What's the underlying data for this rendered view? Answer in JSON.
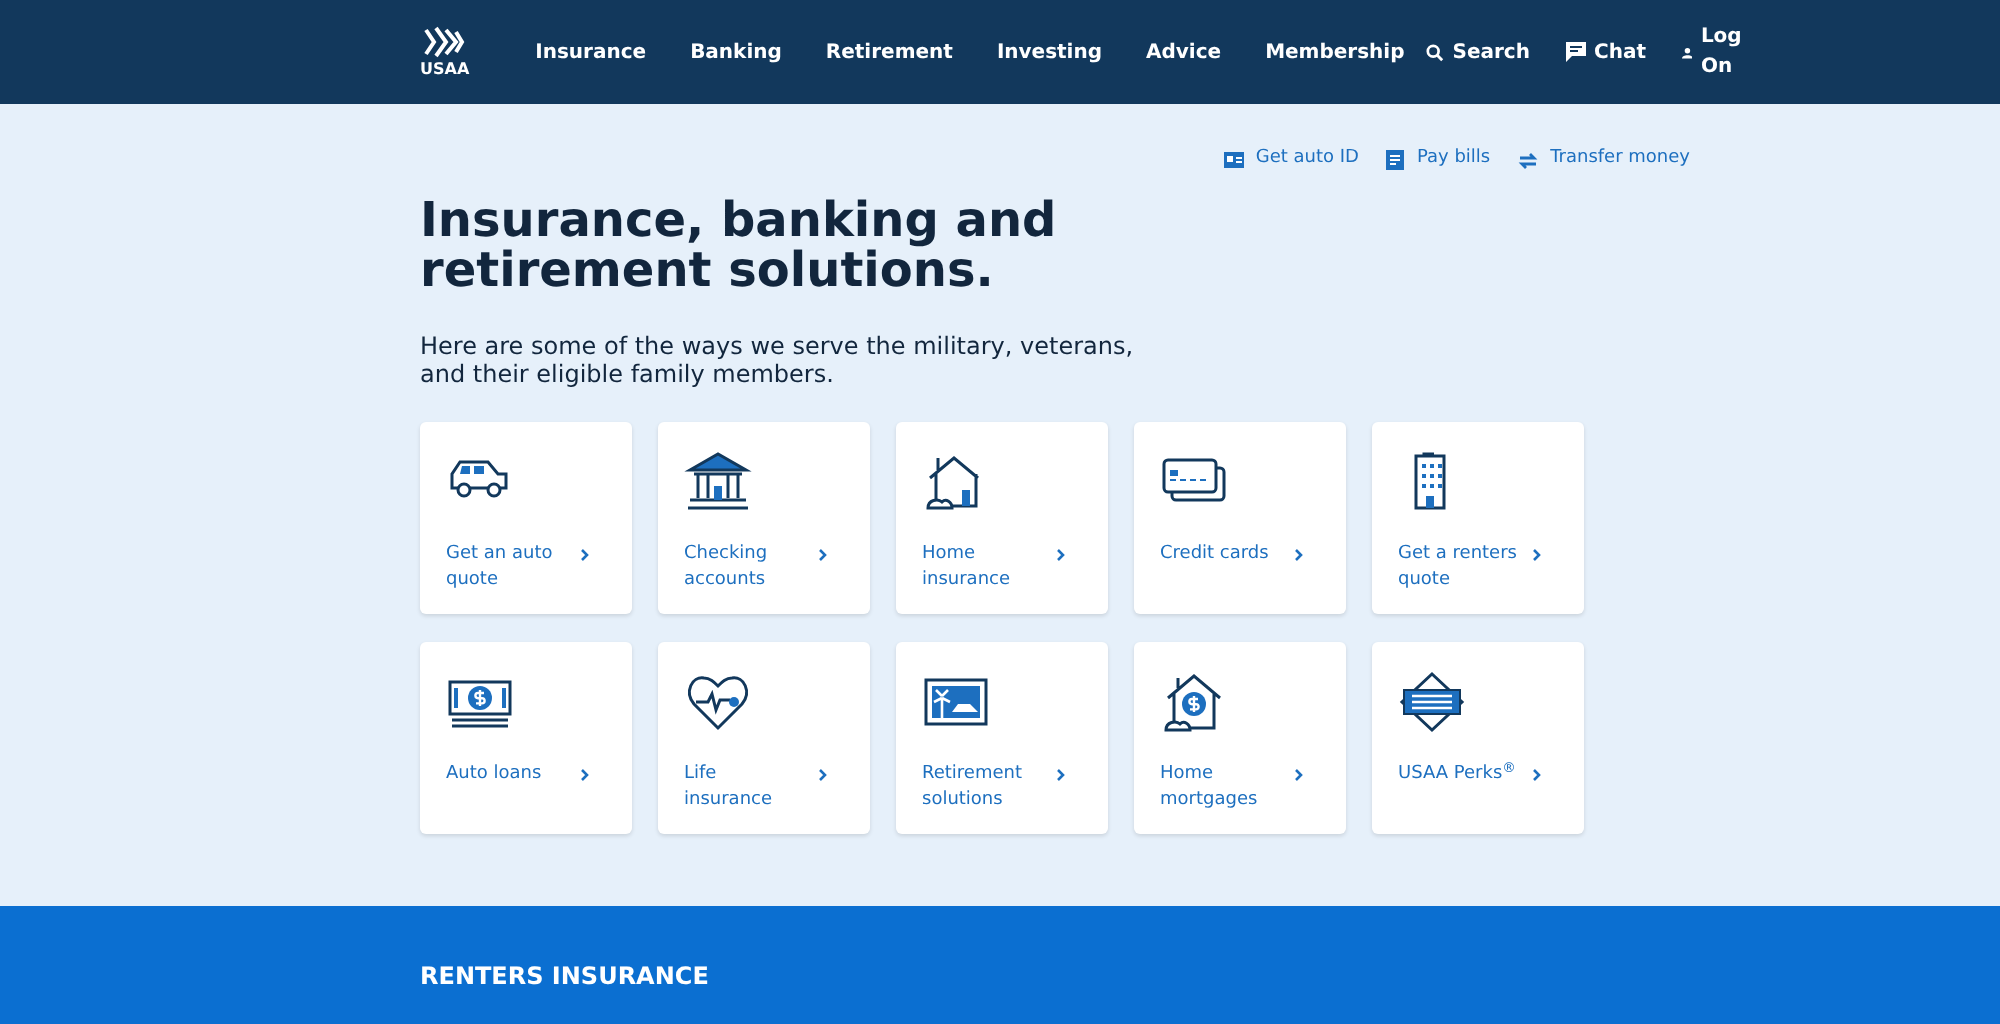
{
  "header": {
    "logo_text": "USAA",
    "nav": [
      "Insurance",
      "Banking",
      "Retirement",
      "Investing",
      "Advice",
      "Membership"
    ],
    "actions": [
      "Search",
      "Chat",
      "Log On"
    ]
  },
  "quick_links": [
    "Get auto ID",
    "Pay bills",
    "Transfer money"
  ],
  "title": "Insurance, banking and retirement solutions.",
  "subtitle": "Here are some of the ways we serve the military, veterans, and their eligible family members.",
  "cards": [
    {
      "label": "Get an auto quote"
    },
    {
      "label": "Checking accounts"
    },
    {
      "label": "Home insurance"
    },
    {
      "label": "Credit cards"
    },
    {
      "label": "Get a renters quote"
    },
    {
      "label": "Auto loans"
    },
    {
      "label": "Life insurance"
    },
    {
      "label": "Retirement solutions"
    },
    {
      "label": "Home mortgages"
    },
    {
      "label": "USAA Perks$^{®}$"
    }
  ],
  "banner": {
    "heading": "RENTERS INSURANCE"
  }
}
